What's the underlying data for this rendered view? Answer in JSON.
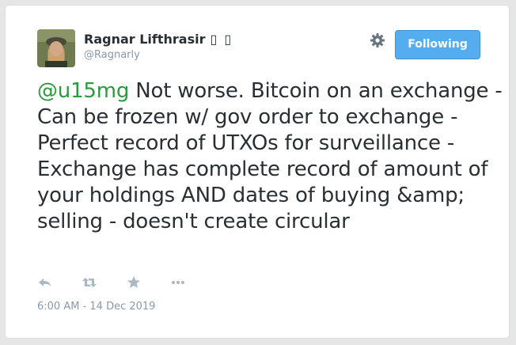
{
  "user": {
    "display_name": "Ragnar Lifthrasir",
    "name_suffix_glyphs": "▯ ▯",
    "handle": "@Ragnarly",
    "avatar_icon": "user-avatar-photo"
  },
  "header": {
    "settings_icon": "gear-icon",
    "follow_button_label": "Following",
    "accent_color": "#55acee"
  },
  "tweet": {
    "mention": "@u15mg",
    "body": " Not worse. Bitcoin on an exchange - Can be frozen w/ gov order to exchange - Perfect record of UTXOs for surveillance - Exchange has complete record of amount of your holdings AND dates of buying &amp; selling - doesn't create circular",
    "mention_color": "#2b9a3f"
  },
  "actions": [
    {
      "icon": "reply-icon"
    },
    {
      "icon": "retweet-icon"
    },
    {
      "icon": "favorite-star-icon"
    },
    {
      "icon": "more-dots-icon"
    }
  ],
  "footer": {
    "timestamp": "6:00 AM - 14 Dec 2019"
  }
}
